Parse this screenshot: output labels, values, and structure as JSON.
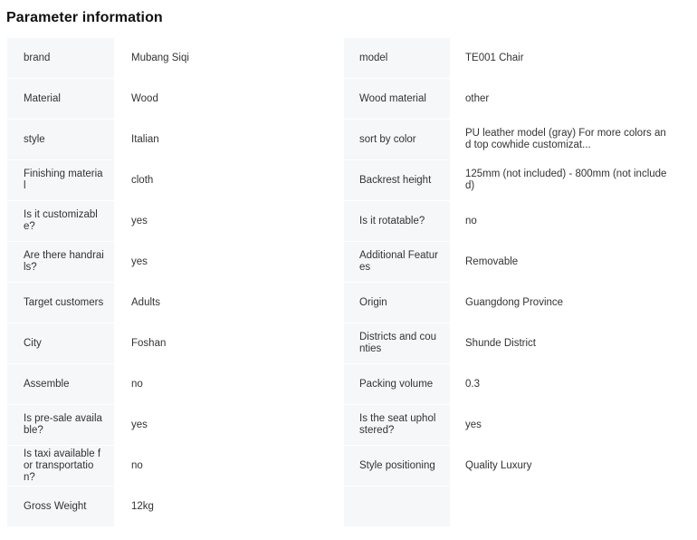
{
  "title": "Parameter information",
  "rows": [
    [
      {
        "k": "brand",
        "v": "Mubang Siqi"
      },
      {
        "k": "model",
        "v": "TE001 Chair"
      }
    ],
    [
      {
        "k": "Material",
        "v": "Wood"
      },
      {
        "k": "Wood material",
        "v": "other"
      }
    ],
    [
      {
        "k": "style",
        "v": "Italian"
      },
      {
        "k": "sort by color",
        "v": "PU leather model (gray) For more colors and top cowhide customizat..."
      }
    ],
    [
      {
        "k": "Finishing material",
        "v": "cloth"
      },
      {
        "k": "Backrest height",
        "v": "125mm (not included) - 800mm (not included)"
      }
    ],
    [
      {
        "k": "Is it customizable?",
        "v": "yes"
      },
      {
        "k": "Is it rotatable?",
        "v": "no"
      }
    ],
    [
      {
        "k": "Are there handrails?",
        "v": "yes"
      },
      {
        "k": "Additional Features",
        "v": "Removable"
      }
    ],
    [
      {
        "k": "Target customers",
        "v": "Adults"
      },
      {
        "k": "Origin",
        "v": "Guangdong Province"
      }
    ],
    [
      {
        "k": "City",
        "v": "Foshan"
      },
      {
        "k": "Districts and counties",
        "v": "Shunde District"
      }
    ],
    [
      {
        "k": "Assemble",
        "v": "no"
      },
      {
        "k": "Packing volume",
        "v": "0.3"
      }
    ],
    [
      {
        "k": "Is pre-sale available?",
        "v": "yes"
      },
      {
        "k": "Is the seat upholstered?",
        "v": "yes"
      }
    ],
    [
      {
        "k": "Is taxi available for transportation?",
        "v": "no"
      },
      {
        "k": "Style positioning",
        "v": "Quality Luxury"
      }
    ],
    [
      {
        "k": "Gross Weight",
        "v": "12kg"
      },
      {
        "k": "",
        "v": ""
      }
    ]
  ]
}
